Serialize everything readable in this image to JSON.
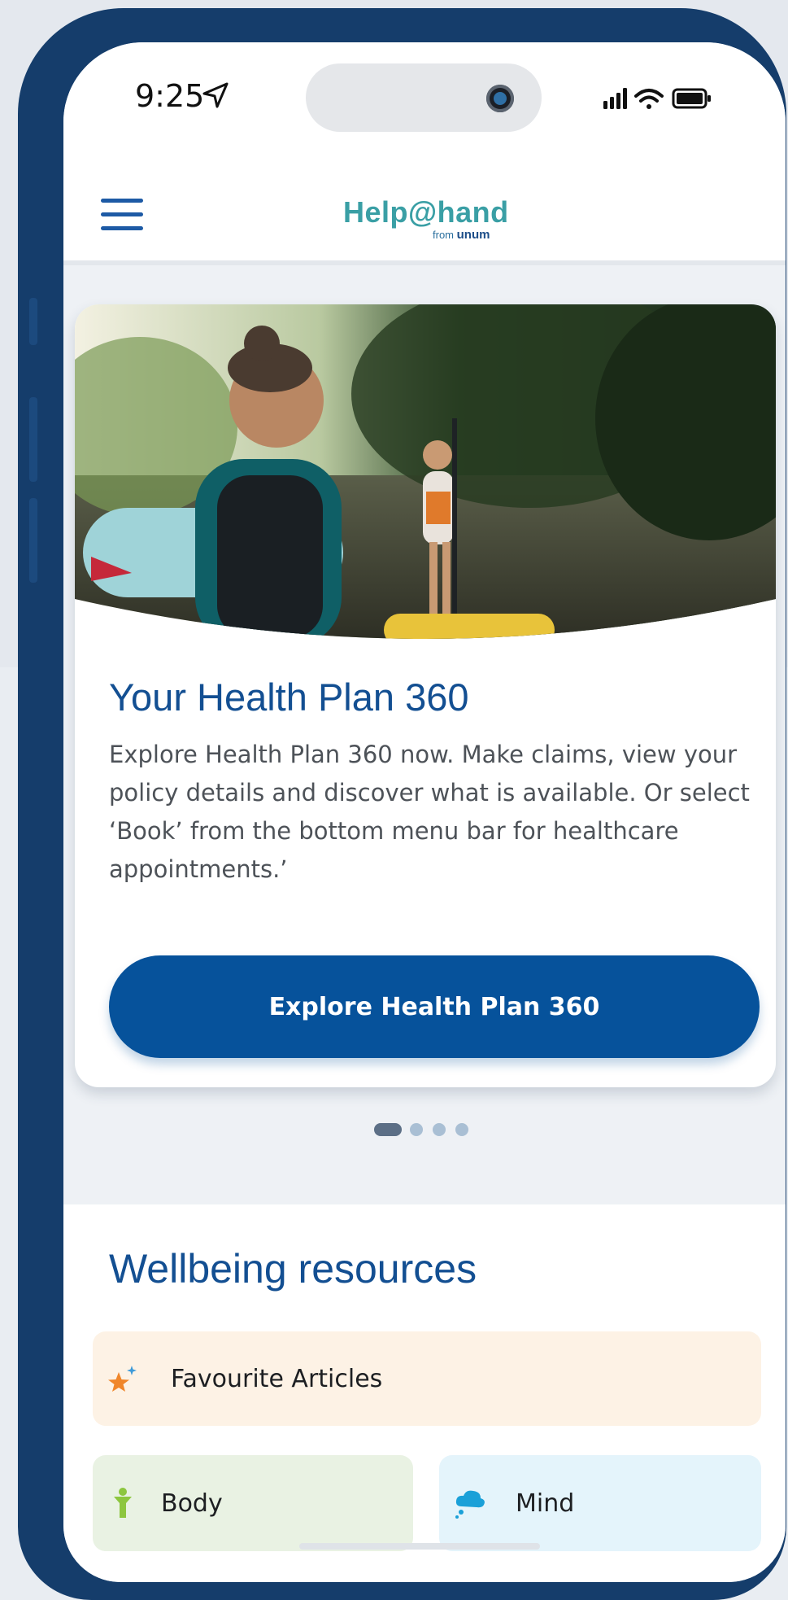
{
  "status_bar": {
    "time": "9:25",
    "icons": [
      "location-arrow-icon",
      "signal-icon",
      "wifi-icon",
      "battery-icon"
    ]
  },
  "app_bar": {
    "menu_icon": "hamburger-menu-icon",
    "logo_main": "Help@hand",
    "logo_from": "from",
    "logo_brand": "unum"
  },
  "hero_card": {
    "title": "Your Health Plan 360",
    "body": "Explore Health Plan 360 now. Make claims, view your policy details and discover what is available. Or select ‘Book’ from the bottom menu bar for healthcare appointments.’",
    "cta_label": "Explore Health Plan 360"
  },
  "carousel": {
    "page_count": 4,
    "active_page": 1
  },
  "wellbeing": {
    "title": "Wellbeing resources",
    "tiles": [
      {
        "label": "Favourite Articles",
        "icon": "star-sparkle-icon",
        "color": "#fdf2e5"
      },
      {
        "label": "Body",
        "icon": "body-figure-icon",
        "color": "#e9f2e3"
      },
      {
        "label": "Mind",
        "icon": "mind-cloud-icon",
        "color": "#e4f4fb"
      }
    ]
  },
  "colors": {
    "brand_primary": "#06529b",
    "heading": "#134f92",
    "phone_frame": "#153d6b",
    "logo_teal": "#3a9fa5"
  }
}
